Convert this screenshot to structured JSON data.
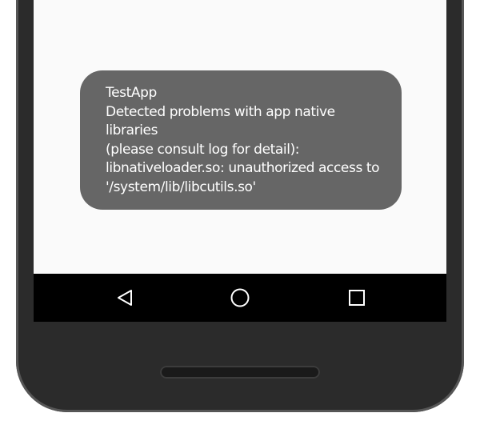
{
  "toast": {
    "app_name": "TestApp",
    "line1": "Detected problems with app native",
    "line2": "libraries",
    "line3": "(please consult log for detail):",
    "line4": "libnativeloader.so: unauthorized access to",
    "line5": "'/system/lib/libcutils.so'"
  },
  "navbar": {
    "back_icon": "back-triangle-icon",
    "home_icon": "home-circle-icon",
    "recents_icon": "recents-square-icon"
  },
  "colors": {
    "toast_bg": "#666666",
    "screen_bg": "#fafafa",
    "navbar_bg": "#000000",
    "phone_body": "#2b2b2b"
  }
}
